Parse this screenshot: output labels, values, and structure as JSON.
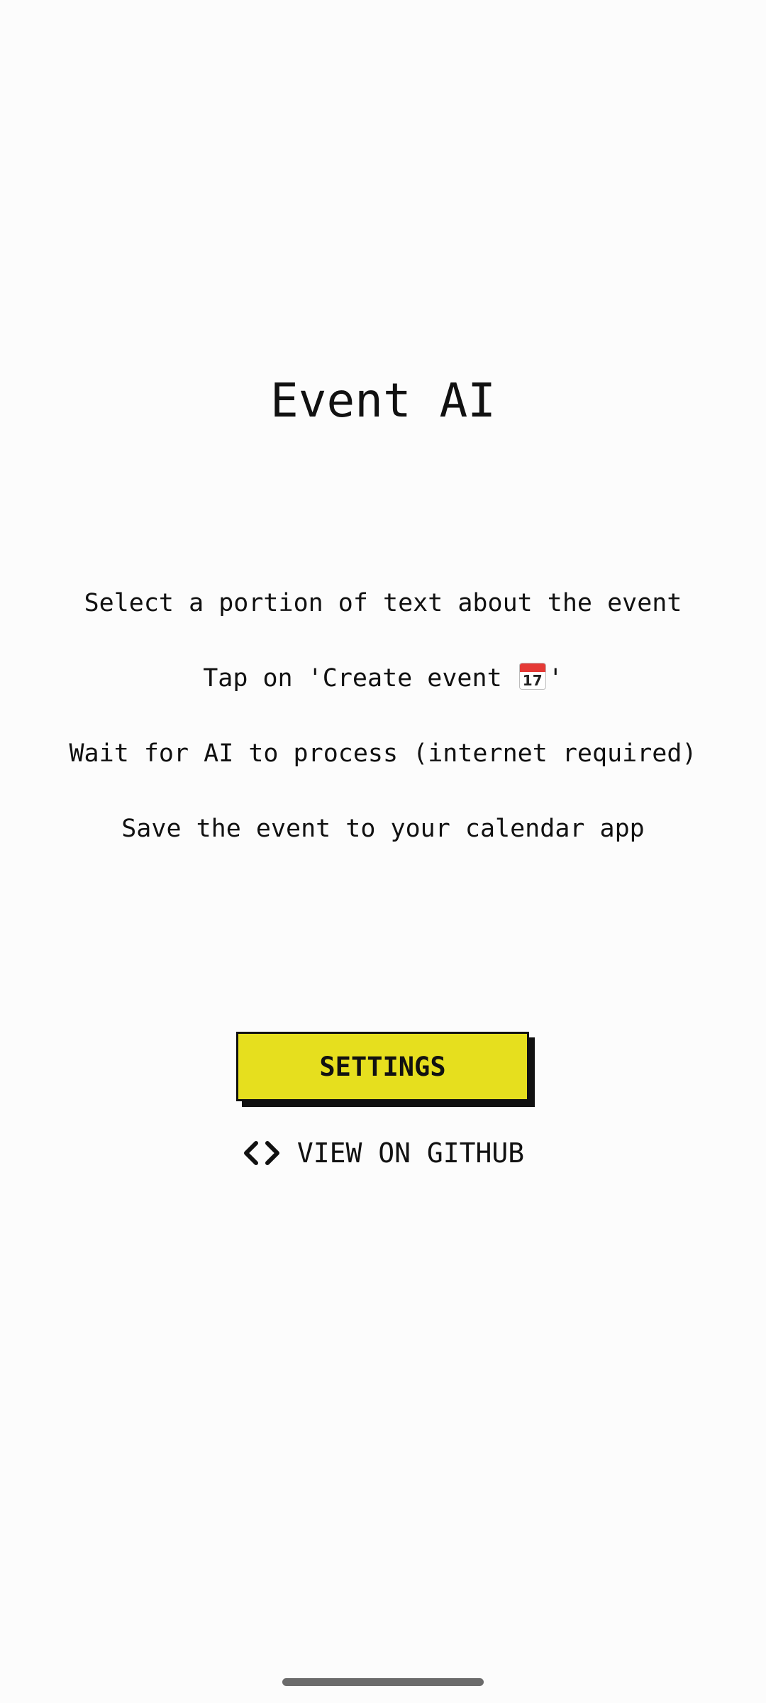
{
  "app": {
    "title": "Event AI"
  },
  "instructions": [
    {
      "text": "Select a portion of text about the event"
    },
    {
      "prefix": "Tap on 'Create event ",
      "emoji_day": "17",
      "emoji_name": "calendar-icon",
      "suffix": "'"
    },
    {
      "text": "Wait for AI to process (internet required)"
    },
    {
      "text": "Save the event to your calendar app"
    }
  ],
  "settings_button": {
    "label": "SETTINGS",
    "background": "#e6df1e"
  },
  "github_link": {
    "label": "VIEW ON GITHUB",
    "icon": "code-icon"
  }
}
